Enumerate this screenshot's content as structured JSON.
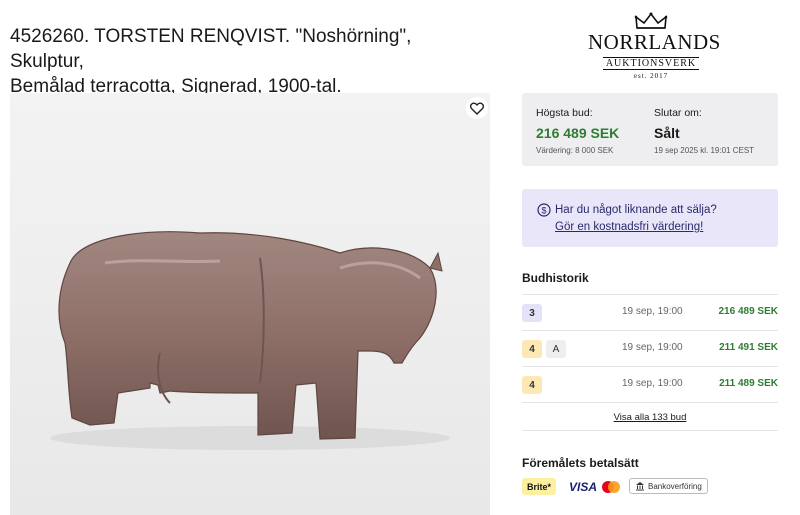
{
  "lot": {
    "title_line1": "4526260. TORSTEN RENQVIST. \"Noshörning\", Skulptur,",
    "title_line2": "Bemålad terracotta, Signerad, 1900-tal."
  },
  "logo": {
    "brand": "NORRLANDS",
    "sub": "AUKTIONSVERK",
    "est": "est. 2017"
  },
  "bid": {
    "highest_label": "Högsta bud:",
    "highest_value": "216 489 SEK",
    "estimate": "Värdering: 8 000 SEK",
    "ends_label": "Slutar om:",
    "ends_value": "Sålt",
    "ends_date": "19 sep 2025 kl. 19:01 CEST"
  },
  "sell": {
    "question": "Har du något liknande att sälja?",
    "link": "Gör en kostnadsfri värdering!"
  },
  "history": {
    "title": "Budhistorik",
    "rows": [
      {
        "badge": "3",
        "extra": "",
        "time": "19 sep, 19:00",
        "amount": "216 489 SEK"
      },
      {
        "badge": "4",
        "extra": "A",
        "time": "19 sep, 19:00",
        "amount": "211 491 SEK"
      },
      {
        "badge": "4",
        "extra": "",
        "time": "19 sep, 19:00",
        "amount": "211 489 SEK"
      }
    ],
    "show_all": "Visa alla 133 bud"
  },
  "payment": {
    "title": "Föremålets betalsätt",
    "brite": "Brite*",
    "visa": "VISA",
    "bank": "Bankoverföring"
  },
  "icons": {
    "heart": "heart-icon",
    "dollar": "dollar-circle-icon",
    "crown": "crown-icon",
    "bank": "bank-icon",
    "mastercard": "mastercard-icon"
  },
  "colors": {
    "bid_green": "#2e7d32",
    "sell_bg": "#e9e6fa",
    "badge_purple": "#e4e2f8",
    "badge_yellow": "#fbe8b4"
  }
}
